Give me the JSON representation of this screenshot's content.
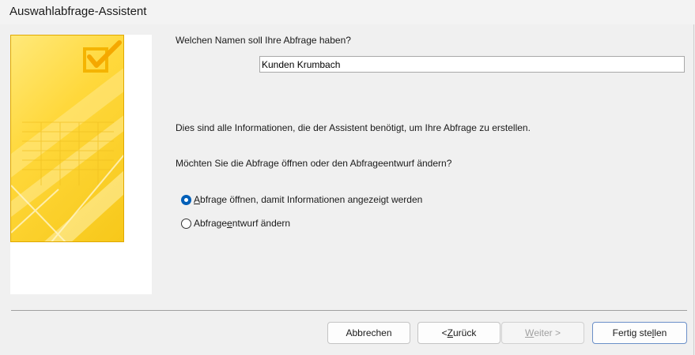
{
  "window": {
    "title": "Auswahlabfrage-Assistent"
  },
  "prompts": {
    "name_question": "Welchen Namen soll Ihre Abfrage haben?",
    "info_text": "Dies sind alle Informationen, die der Assistent benötigt, um Ihre Abfrage zu erstellen.",
    "open_or_modify_question": "Möchten Sie die Abfrage öffnen oder den Abfrageentwurf ändern?"
  },
  "query_name": {
    "value": "Kunden Krumbach"
  },
  "options": [
    {
      "pre": "",
      "key": "A",
      "post": "bfrage öffnen, damit Informationen angezeigt werden",
      "selected": true
    },
    {
      "pre": "Abfrage",
      "key": "e",
      "post": "ntwurf ändern",
      "selected": false
    }
  ],
  "buttons": {
    "cancel": {
      "label": "Abbrechen"
    },
    "back": {
      "pre": "< ",
      "key": "Z",
      "post": "urück"
    },
    "next": {
      "pre": "",
      "key": "W",
      "post": "eiter >",
      "enabled": false
    },
    "finish": {
      "pre": "Fertig ste",
      "key": "l",
      "post": "len"
    }
  },
  "colors": {
    "accent": "#005fb8",
    "graphic_yellow": "#ffd83b",
    "graphic_orange": "#f5b400"
  }
}
